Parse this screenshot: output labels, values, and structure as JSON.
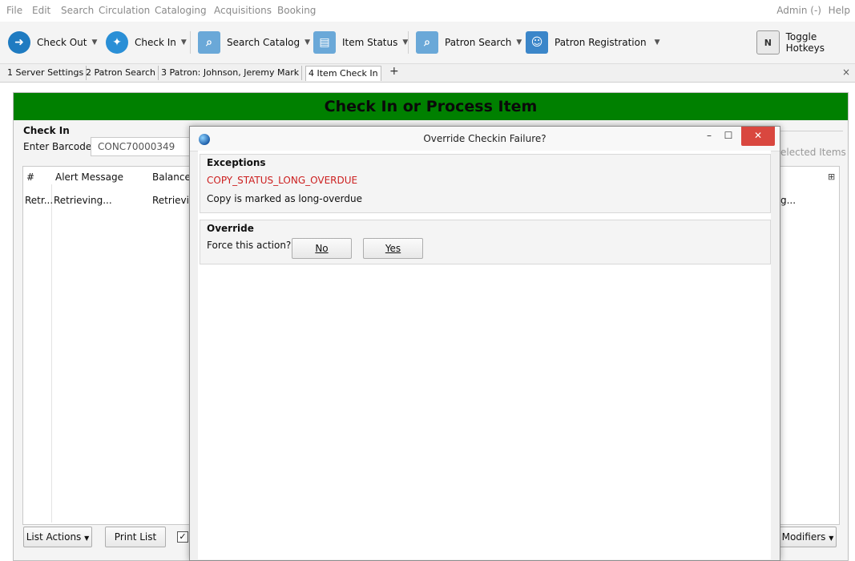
{
  "menubar": {
    "items": [
      "File",
      "Edit",
      "Search",
      "Circulation",
      "Cataloging",
      "Acquisitions",
      "Booking"
    ],
    "admin": "Admin (-)",
    "help": "Help"
  },
  "toolbar": {
    "check_out": "Check Out",
    "check_in": "Check In",
    "search_catalog": "Search Catalog",
    "item_status": "Item Status",
    "patron_search": "Patron Search",
    "patron_registration": "Patron Registration",
    "toggle_hotkeys": "Toggle Hotkeys"
  },
  "tabs": [
    {
      "label": "1 Server Settings"
    },
    {
      "label": "2 Patron Search"
    },
    {
      "label": "3 Patron: Johnson, Jeremy Mark"
    },
    {
      "label": "4 Item Check In"
    }
  ],
  "tabs_close": "×",
  "tabs_add": "+",
  "panel": {
    "banner": "Check In or Process Item",
    "section_label": "Check In",
    "barcode_label": "Enter Barcode:",
    "barcode_value": "CONC70000349",
    "columns": [
      "#",
      "Alert Message",
      "Balance"
    ],
    "row": [
      "Retr...",
      "Retrieving...",
      "Retrievin"
    ],
    "right_label": "elected Items",
    "right_row": "g...",
    "list_actions": "List Actions",
    "print_list": "Print List",
    "modifiers": "Modifiers"
  },
  "dialog": {
    "title": "Override Checkin Failure?",
    "exceptions_label": "Exceptions",
    "exception_code": "COPY_STATUS_LONG_OVERDUE",
    "exception_text": "Copy is marked as long-overdue",
    "override_label": "Override",
    "force_question": "Force this action?",
    "no": "No",
    "yes": "Yes"
  },
  "colors": {
    "banner": "#008000",
    "exception_code": "#cc1f1f",
    "close_button": "#d9473f"
  }
}
